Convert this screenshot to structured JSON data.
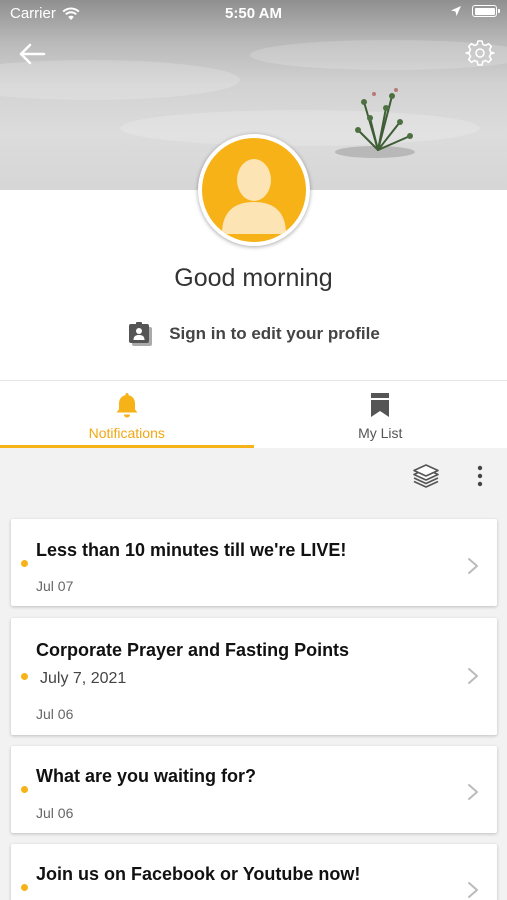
{
  "status_bar": {
    "carrier": "Carrier",
    "time": "5:50 AM"
  },
  "profile": {
    "greeting": "Good morning",
    "signin_label": "Sign in to edit your profile"
  },
  "tabs": [
    {
      "label": "Notifications",
      "icon": "bell-icon",
      "active": true
    },
    {
      "label": "My List",
      "icon": "bookmark-icon",
      "active": false
    }
  ],
  "notifications": [
    {
      "title": "Less than 10 minutes till we're LIVE!",
      "subtitle": "",
      "date": "Jul 07",
      "unread": true
    },
    {
      "title": "Corporate Prayer and Fasting Points",
      "subtitle": "July 7, 2021",
      "date": "Jul 06",
      "unread": true
    },
    {
      "title": "What are you waiting for?",
      "subtitle": "",
      "date": "Jul 06",
      "unread": true
    },
    {
      "title": "Join us on Facebook or Youtube now!",
      "subtitle": "",
      "date": "",
      "unread": true
    }
  ],
  "colors": {
    "accent": "#f6b216",
    "accent_text": "#f0a712",
    "background": "#f2f2f2"
  }
}
